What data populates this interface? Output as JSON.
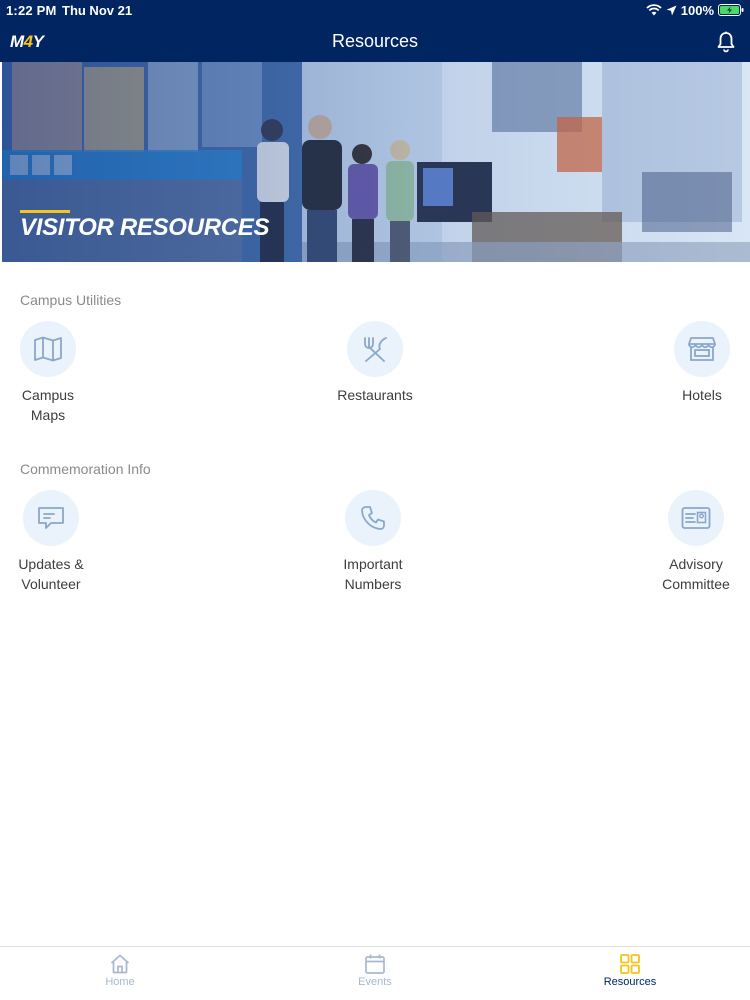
{
  "status_bar": {
    "time": "1:22 PM",
    "date": "Thu Nov 21",
    "battery": "100%"
  },
  "header": {
    "logo_prefix": "M",
    "logo_accent": "4",
    "logo_suffix": "Y",
    "title": "Resources",
    "bell_icon": "bell-icon"
  },
  "hero": {
    "title": "VISITOR RESOURCES",
    "accent_color": "#f5c518"
  },
  "sections": [
    {
      "label": "Campus Utilities",
      "items": [
        {
          "label_line1": "Campus",
          "label_line2": "Maps",
          "icon": "map-icon"
        },
        {
          "label_line1": "Restaurants",
          "label_line2": "",
          "icon": "utensils-icon"
        },
        {
          "label_line1": "Hotels",
          "label_line2": "",
          "icon": "storefront-icon"
        }
      ]
    },
    {
      "label": "Commemoration Info",
      "items": [
        {
          "label_line1": "Updates &",
          "label_line2": "Volunteer",
          "icon": "message-icon"
        },
        {
          "label_line1": "Important",
          "label_line2": "Numbers",
          "icon": "phone-icon"
        },
        {
          "label_line1": "Advisory",
          "label_line2": "Committee",
          "icon": "id-card-icon"
        }
      ]
    }
  ],
  "tabbar": {
    "tabs": [
      {
        "label": "Home",
        "icon": "home-icon",
        "active": false
      },
      {
        "label": "Events",
        "icon": "calendar-icon",
        "active": false
      },
      {
        "label": "Resources",
        "icon": "grid-icon",
        "active": true
      }
    ],
    "active_color": "#f5c518",
    "inactive_color": "#a8b9cf"
  },
  "colors": {
    "nav_background": "#012560",
    "icon_circle": "#eaf2fb",
    "icon_stroke": "#8aa7cc"
  }
}
